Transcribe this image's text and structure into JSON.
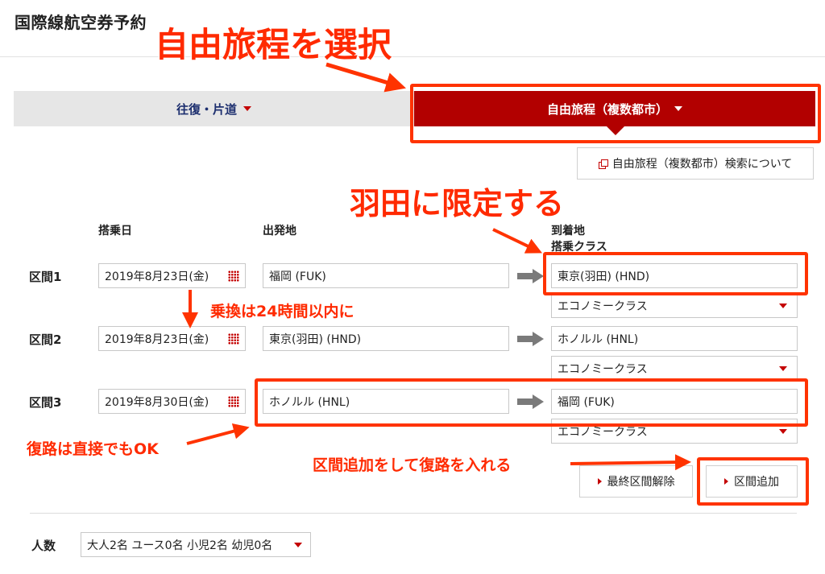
{
  "header": {
    "title": "国際線航空券予約"
  },
  "tabs": {
    "roundtrip": "往復・片道",
    "multicity": "自由旅程（複数都市）"
  },
  "about_link": "自由旅程（複数都市）検索について",
  "columns": {
    "date": "搭乗日",
    "origin": "出発地",
    "destination": "到着地",
    "cabin": "搭乗クラス"
  },
  "segments": [
    {
      "label": "区間1",
      "date": "2019年8月23日(金)",
      "origin": "福岡 (FUK)",
      "destination": "東京(羽田) (HND)",
      "cabin": "エコノミークラス"
    },
    {
      "label": "区間2",
      "date": "2019年8月23日(金)",
      "origin": "東京(羽田) (HND)",
      "destination": "ホノルル (HNL)",
      "cabin": "エコノミークラス"
    },
    {
      "label": "区間3",
      "date": "2019年8月30日(金)",
      "origin": "ホノルル (HNL)",
      "destination": "福岡 (FUK)",
      "cabin": "エコノミークラス"
    }
  ],
  "buttons": {
    "remove_last": "最終区間解除",
    "add_segment": "区間追加"
  },
  "passengers": {
    "label": "人数",
    "value": "大人2名 ユース0名 小児2名 幼児0名"
  },
  "annotations": {
    "select_multicity": "自由旅程を選択",
    "limit_haneda": "羽田に限定する",
    "transfer_24h": "乗換は24時間以内に",
    "return_direct": "復路は直接でもOK",
    "add_return": "区間追加をして復路を入れる"
  },
  "colors": {
    "brand_red": "#b20000",
    "annotation": "#ff3300",
    "tab_text": "#1d2f6f"
  }
}
